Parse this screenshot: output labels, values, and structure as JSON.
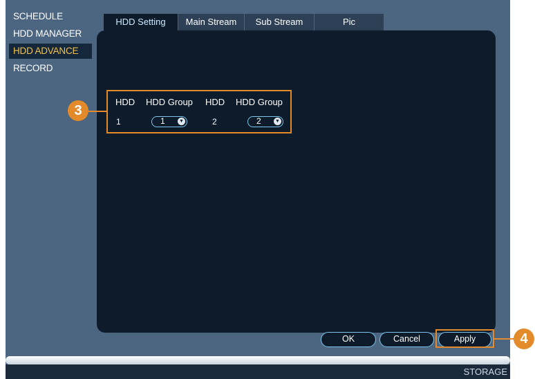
{
  "sidebar": {
    "items": [
      {
        "label": "SCHEDULE"
      },
      {
        "label": "HDD MANAGER"
      },
      {
        "label": "HDD ADVANCE"
      },
      {
        "label": "RECORD"
      }
    ]
  },
  "tabs": [
    {
      "label": "HDD Setting"
    },
    {
      "label": "Main Stream"
    },
    {
      "label": "Sub Stream"
    },
    {
      "label": "Pic"
    }
  ],
  "hdd_table": {
    "headers": [
      "HDD",
      "HDD Group",
      "HDD",
      "HDD Group"
    ],
    "rows": [
      {
        "hdd": "1",
        "group": "1"
      },
      {
        "hdd": "2",
        "group": "2"
      }
    ]
  },
  "callouts": {
    "hdd_group": "3",
    "apply": "4"
  },
  "buttons": {
    "ok": "OK",
    "cancel": "Cancel",
    "apply": "Apply"
  },
  "status": "STORAGE",
  "colors": {
    "background": "#4c6581",
    "panel": "#0e1b2b",
    "accent": "#e38a2b",
    "active_text": "#f0c24c",
    "control_border": "#7dc6ee"
  }
}
